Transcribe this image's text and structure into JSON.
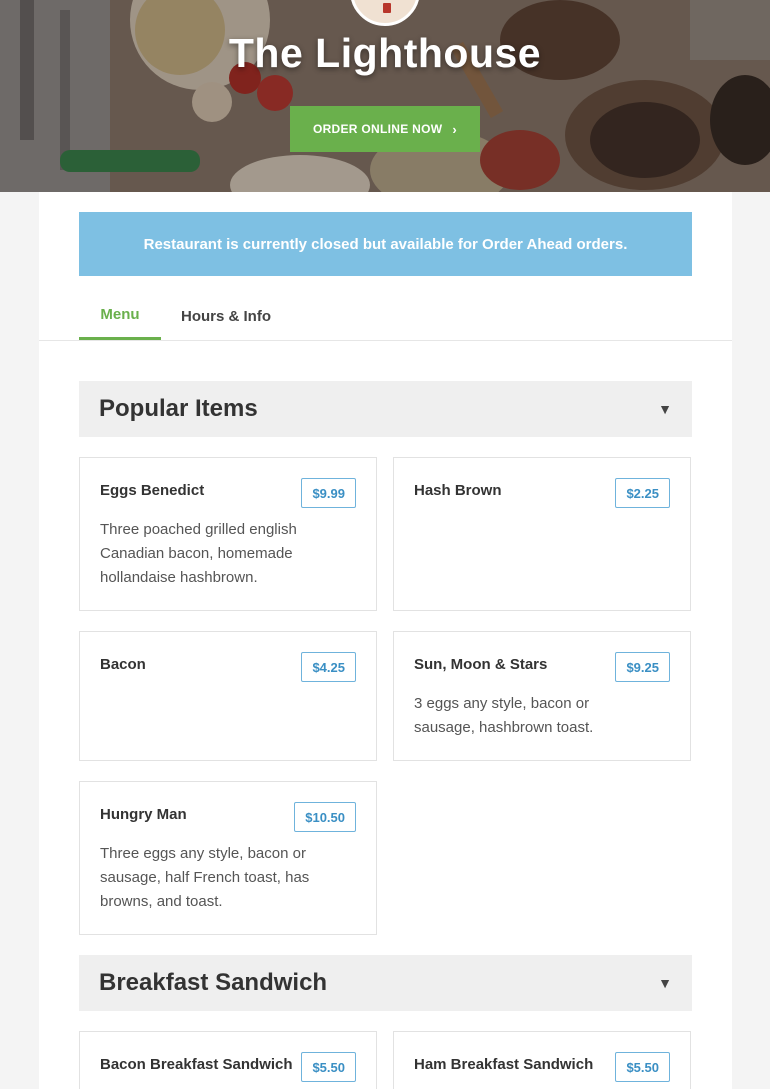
{
  "restaurant": {
    "name": "The Lighthouse",
    "order_button_label": "ORDER ONLINE NOW"
  },
  "notice": "Restaurant is currently closed but available for Order Ahead orders.",
  "tabs": [
    {
      "label": "Menu",
      "active": true
    },
    {
      "label": "Hours & Info",
      "active": false
    }
  ],
  "sections": [
    {
      "title": "Popular Items",
      "items": [
        {
          "name": "Eggs Benedict",
          "price": "$9.99",
          "description": "Three poached grilled english Canadian bacon, homemade hollandaise hashbrown."
        },
        {
          "name": "Hash Brown",
          "price": "$2.25",
          "description": ""
        },
        {
          "name": "Bacon",
          "price": "$4.25",
          "description": ""
        },
        {
          "name": "Sun, Moon & Stars",
          "price": "$9.25",
          "description": "3 eggs any style, bacon or sausage, hashbrown toast."
        },
        {
          "name": "Hungry Man",
          "price": "$10.50",
          "description": "Three eggs any style, bacon or sausage, half French toast, has browns, and toast."
        }
      ]
    },
    {
      "title": "Breakfast Sandwich",
      "items": [
        {
          "name": "Bacon Breakfast Sandwich",
          "price": "$5.50",
          "description": ""
        },
        {
          "name": "Ham Breakfast Sandwich",
          "price": "$5.50",
          "description": ""
        }
      ]
    }
  ],
  "colors": {
    "accent_green": "#6ab04c",
    "notice_blue": "#7ec0e3",
    "price_blue": "#3a8fc4"
  },
  "icons": {
    "order_chevron": "chevron-right-icon",
    "section_caret": "caret-down-icon"
  }
}
